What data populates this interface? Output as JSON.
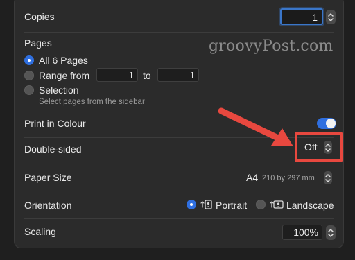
{
  "copies": {
    "label": "Copies",
    "value": "1"
  },
  "pages": {
    "label": "Pages",
    "options": [
      {
        "label": "All 6 Pages",
        "selected": true
      },
      {
        "label": "Range from",
        "selected": false
      },
      {
        "label": "Selection",
        "selected": false
      }
    ],
    "range_from": "1",
    "range_to_label": "to",
    "range_to": "1",
    "selection_hint": "Select pages from the sidebar"
  },
  "watermark": "groovyPost.com",
  "print_in_colour": {
    "label": "Print in Colour",
    "on": true
  },
  "double_sided": {
    "label": "Double-sided",
    "value": "Off"
  },
  "paper_size": {
    "label": "Paper Size",
    "value": "A4",
    "detail": "210 by 297 mm"
  },
  "orientation": {
    "label": "Orientation",
    "options": [
      {
        "label": "Portrait",
        "selected": true
      },
      {
        "label": "Landscape",
        "selected": false
      }
    ]
  },
  "scaling": {
    "label": "Scaling",
    "value": "100%"
  },
  "colors": {
    "accent": "#2f6fe0",
    "annotation": "#e8483f",
    "focus": "#3a76c9"
  }
}
